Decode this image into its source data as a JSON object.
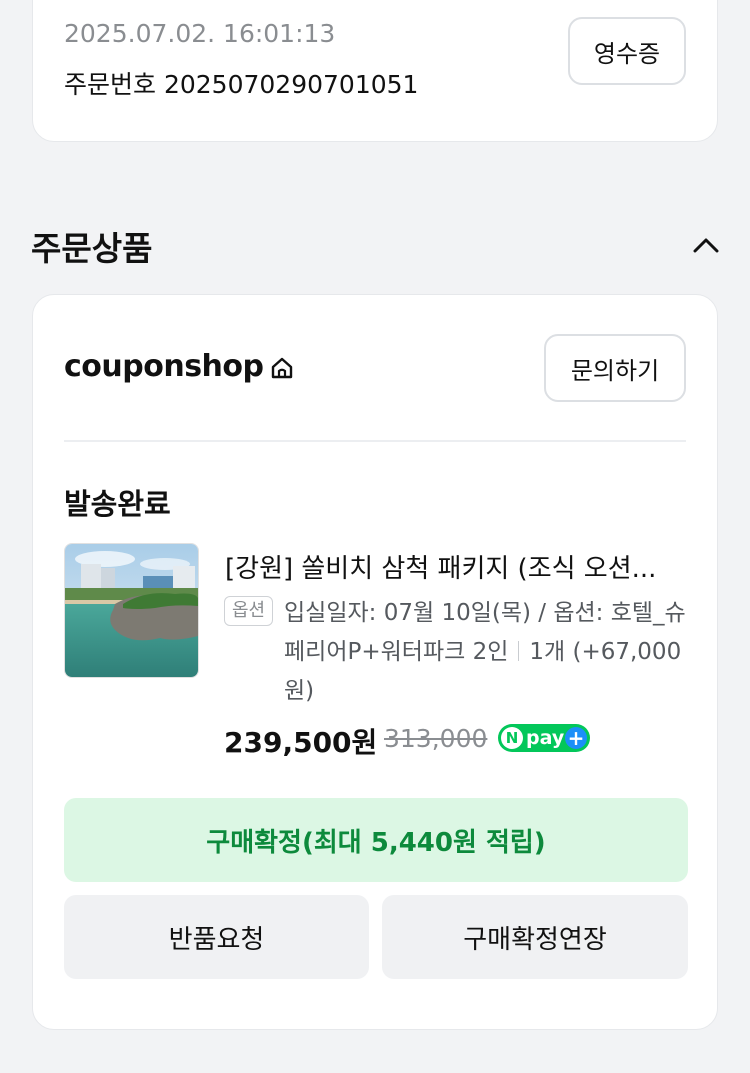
{
  "order": {
    "datetime": "2025.07.02. 16:01:13",
    "number_text": "주문번호 2025070290701051",
    "receipt_label": "영수증"
  },
  "section": {
    "title": "주문상품",
    "chevron_icon": "chevron-up-icon"
  },
  "shop": {
    "name": "couponshop",
    "home_icon": "home-icon",
    "inquiry_label": "문의하기"
  },
  "item": {
    "status": "발송완료",
    "title": "[강원] 쏠비치 삼척 패키지 (조식 오션...",
    "option_badge": "옵션",
    "option_main": "입실일자: 07월 10일(목) / 옵션: 호텔_슈페리어P+워터파크 2인",
    "option_qty": "1개 (+67,000원)",
    "price": "239,500원",
    "original_price": "313,000",
    "npay_n": "N",
    "npay_text": "pay",
    "npay_plus": "+"
  },
  "actions": {
    "confirm": "구매확정(최대 5,440원 적립)",
    "return": "반품요청",
    "extend": "구매확정연장"
  },
  "colors": {
    "confirm_bg": "#dcf7e4",
    "confirm_text": "#0d8a3c",
    "npay_green": "#03c75a",
    "npay_blue": "#1c8ff8"
  }
}
